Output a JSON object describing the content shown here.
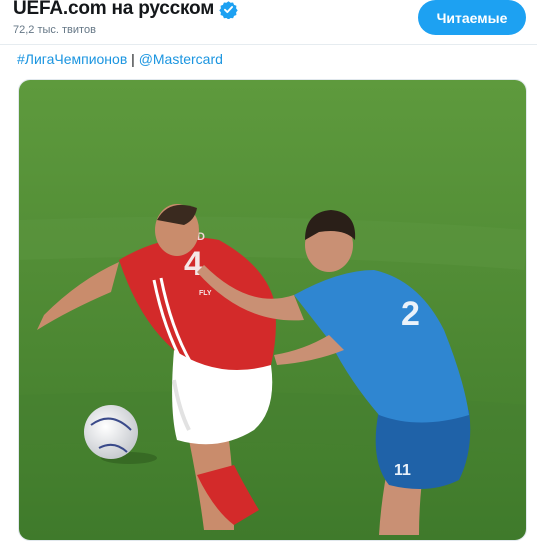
{
  "account": {
    "name": "UEFA.com на русском",
    "verified_icon": "verified-badge-icon",
    "tweet_count": "72,2 тыс. твитов"
  },
  "follow_button": {
    "label": "Читаемые"
  },
  "tweet": {
    "hashtag": "#ЛигаЧемпионов",
    "separator": "|",
    "mention": "@Mastercard"
  },
  "media": {
    "kind": "video-still",
    "jersey_red_text": "TODD",
    "jersey_red_number": "4",
    "jersey_red_sponsor": "FLY",
    "jersey_blue_number": "2",
    "shorts_number": "11"
  },
  "colors": {
    "accent": "#1da1f2",
    "link": "#1b95e0",
    "pitch": "#4f8a34",
    "red_kit": "#d32a2a",
    "blue_kit": "#2f86d1"
  }
}
